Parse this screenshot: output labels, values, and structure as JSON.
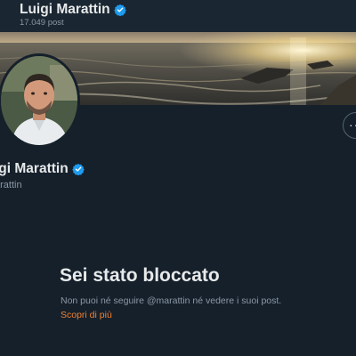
{
  "header": {
    "name": "Luigi Marattin",
    "post_count": "17.049 post"
  },
  "profile": {
    "name": "igi Marattin",
    "handle": "arattin",
    "verified": true,
    "verified_color": "#1d9bf0"
  },
  "blocked": {
    "title": "Sei stato bloccato",
    "description": "Non puoi né seguire @marattin né vedere i suoi post.",
    "learn_more": "Scopri di più",
    "link_color": "#f4812f"
  },
  "icons": {
    "verified": "verified-badge-icon",
    "more": "more-options-icon"
  },
  "theme": {
    "background": "#15202b",
    "text": "#e7e9ea",
    "muted": "#8b98a5"
  }
}
